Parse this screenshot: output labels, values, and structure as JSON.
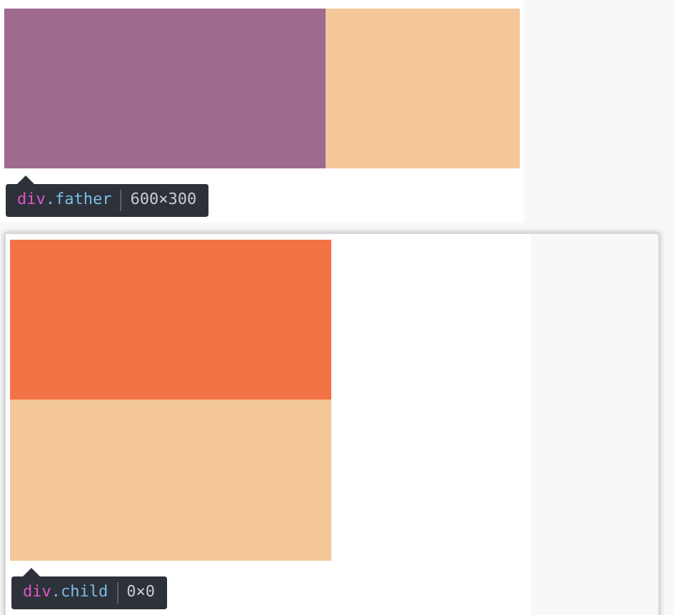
{
  "panels": [
    {
      "tooltip": {
        "tag": "div",
        "class": ".father",
        "size": "600×300"
      }
    },
    {
      "tooltip": {
        "tag": "div",
        "class": ".child",
        "size": "0×0"
      }
    }
  ]
}
